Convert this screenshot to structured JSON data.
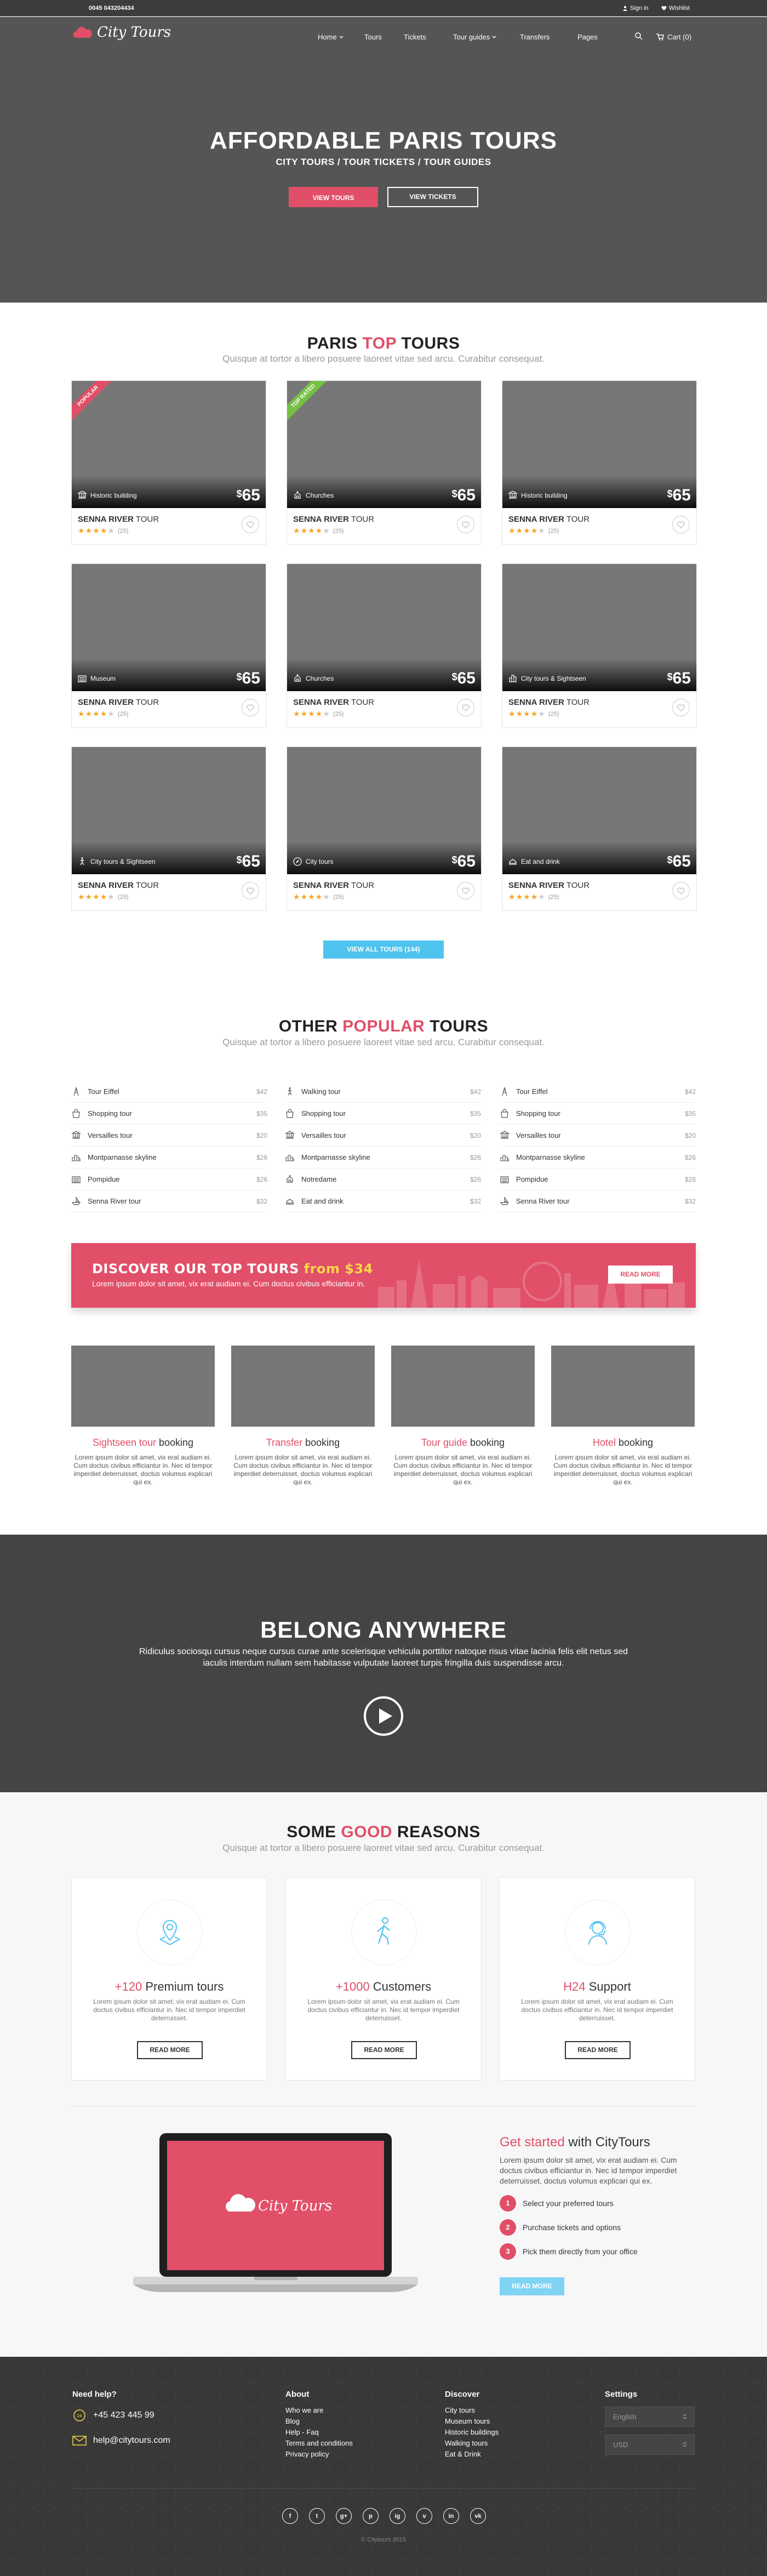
{
  "topbar": {
    "phone": "0045 043204434",
    "signin": "Sign in",
    "wishlist": "Wishlist"
  },
  "header": {
    "brand": "City Tours",
    "nav": [
      "Home",
      "Tours",
      "Tickets",
      "Tour guides",
      "Transfers",
      "Pages"
    ],
    "cart": "Cart (0)"
  },
  "hero": {
    "title": "AFFORDABLE PARIS TOURS",
    "subtitle": "CITY TOURS / TOUR TICKETS / TOUR GUIDES",
    "btn_tours": "VIEW TOURS",
    "btn_tickets": "VIEW TICKETS"
  },
  "top_tours": {
    "title_a": "PARIS ",
    "title_hl": "TOP",
    "title_b": " TOURS",
    "subtitle": "Quisque at tortor a libero posuere laoreet vitae sed arcu. Curabitur consequat.",
    "cards": [
      {
        "ribbon": "POPULAR",
        "ribbon_color": "#e04f67",
        "category": "Historic building",
        "icon": "historic-icon",
        "price": "65",
        "name_a": "SENNA RIVER",
        "name_b": " TOUR",
        "stars": 4,
        "reviews": "(25)"
      },
      {
        "ribbon": "TOP RATED",
        "ribbon_color": "#76c043",
        "category": "Churches",
        "icon": "church-icon",
        "price": "65",
        "name_a": "SENNA RIVER",
        "name_b": " TOUR",
        "stars": 4,
        "reviews": "(25)"
      },
      {
        "ribbon": "",
        "ribbon_color": "",
        "category": "Historic building",
        "icon": "historic-icon",
        "price": "65",
        "name_a": "SENNA RIVER",
        "name_b": " TOUR",
        "stars": 4,
        "reviews": "(25)"
      },
      {
        "ribbon": "",
        "ribbon_color": "",
        "category": "Museum",
        "icon": "museum-icon",
        "price": "65",
        "name_a": "SENNA RIVER",
        "name_b": " TOUR",
        "stars": 4,
        "reviews": "(25)"
      },
      {
        "ribbon": "",
        "ribbon_color": "",
        "category": "Churches",
        "icon": "church-icon",
        "price": "65",
        "name_a": "SENNA RIVER",
        "name_b": " TOUR",
        "stars": 4,
        "reviews": "(25)"
      },
      {
        "ribbon": "",
        "ribbon_color": "",
        "category": "City tours & Sightseen",
        "icon": "city-icon",
        "price": "65",
        "name_a": "SENNA RIVER",
        "name_b": " TOUR",
        "stars": 4,
        "reviews": "(25)"
      },
      {
        "ribbon": "",
        "ribbon_color": "",
        "category": "City tours & Sightseen",
        "icon": "walking-icon",
        "price": "65",
        "name_a": "SENNA RIVER",
        "name_b": " TOUR",
        "stars": 4,
        "reviews": "(25)"
      },
      {
        "ribbon": "",
        "ribbon_color": "",
        "category": "City tours",
        "icon": "compass-icon",
        "price": "65",
        "name_a": "SENNA RIVER",
        "name_b": " TOUR",
        "stars": 4,
        "reviews": "(25)"
      },
      {
        "ribbon": "",
        "ribbon_color": "",
        "category": "Eat and drink",
        "icon": "food-icon",
        "price": "65",
        "name_a": "SENNA RIVER",
        "name_b": " TOUR",
        "stars": 4,
        "reviews": "(25)"
      }
    ],
    "view_all": "VIEW ALL TOURS (144)"
  },
  "popular": {
    "title_a": "OTHER ",
    "title_hl": "POPULAR",
    "title_b": " TOURS",
    "subtitle": "Quisque at tortor a libero posuere laoreet vitae sed arcu. Curabitur consequat.",
    "columns": [
      [
        {
          "name": "Tour Eiffel",
          "price": "$42",
          "icon": "eiffel-icon"
        },
        {
          "name": "Shopping tour",
          "price": "$35",
          "icon": "shopping-icon"
        },
        {
          "name": "Versailles tour",
          "price": "$20",
          "icon": "historic-icon"
        },
        {
          "name": "Montparnasse skyline",
          "price": "$26",
          "icon": "skyline-icon"
        },
        {
          "name": "Pompidue",
          "price": "$26",
          "icon": "museum-icon"
        },
        {
          "name": "Senna River tour",
          "price": "$32",
          "icon": "boat-icon"
        }
      ],
      [
        {
          "name": "Walking tour",
          "price": "$42",
          "icon": "walking-icon"
        },
        {
          "name": "Shopping tour",
          "price": "$35",
          "icon": "shopping-icon"
        },
        {
          "name": "Versailles tour",
          "price": "$20",
          "icon": "historic-icon"
        },
        {
          "name": "Montparnasse skyline",
          "price": "$26",
          "icon": "skyline-icon"
        },
        {
          "name": "Notredame",
          "price": "$26",
          "icon": "church-icon"
        },
        {
          "name": "Eat and drink",
          "price": "$32",
          "icon": "food-icon"
        }
      ],
      [
        {
          "name": "Tour Eiffel",
          "price": "$42",
          "icon": "eiffel-icon"
        },
        {
          "name": "Shopping tour",
          "price": "$35",
          "icon": "shopping-icon"
        },
        {
          "name": "Versailles tour",
          "price": "$20",
          "icon": "historic-icon"
        },
        {
          "name": "Montparnasse skyline",
          "price": "$26",
          "icon": "skyline-icon"
        },
        {
          "name": "Pompidue",
          "price": "$26",
          "icon": "museum-icon"
        },
        {
          "name": "Senna River tour",
          "price": "$32",
          "icon": "boat-icon"
        }
      ]
    ]
  },
  "banner": {
    "title_a": "DISCOVER OUR TOP TOURS ",
    "title_hl": "from $34",
    "subtitle": "Lorem ipsum dolor sit amet, vix erat audiam ei. Cum doctus civibus efficiantur in.",
    "button": "READ MORE"
  },
  "features": [
    {
      "hl": "Sightseen tour",
      "rest": " booking",
      "text": "Lorem ipsum dolor sit amet, vix erat audiam ei. Cum doctus civibus efficiantur in. Nec id tempor imperdiet deterruisset, doctus volumus explicari qui ex."
    },
    {
      "hl": "Transfer",
      "rest": " booking",
      "text": "Lorem ipsum dolor sit amet, vix erat audiam ei. Cum doctus civibus efficiantur in. Nec id tempor imperdiet deterruisset, doctus volumus explicari qui ex."
    },
    {
      "hl": "Tour guide",
      "rest": " booking",
      "text": "Lorem ipsum dolor sit amet, vix erat audiam ei. Cum doctus civibus efficiantur in. Nec id tempor imperdiet deterruisset, doctus volumus explicari qui ex."
    },
    {
      "hl": "Hotel",
      "rest": " booking",
      "text": "Lorem ipsum dolor sit amet, vix erat audiam ei. Cum doctus civibus efficiantur in. Nec id tempor imperdiet deterruisset, doctus volumus explicari qui ex."
    }
  ],
  "video": {
    "title": "BELONG ANYWHERE",
    "text": "Ridiculus sociosqu cursus neque cursus curae ante scelerisque vehicula porttitor natoque risus vitae lacinia felis elit netus sed iaculis interdum nullam sem habitasse vulputate laoreet turpis fringilla duis suspendisse arcu."
  },
  "reasons": {
    "title_a": "SOME ",
    "title_hl": "GOOD",
    "title_b": " REASONS",
    "subtitle": "Quisque at tortor a libero posuere laoreet vitae sed arcu. Curabitur consequat.",
    "boxes": [
      {
        "hl": "+120",
        "rest": " Premium tours",
        "text": "Lorem ipsum dolor sit amet, vix erat audiam ei. Cum doctus civibus efficiantur in. Nec id tempor imperdiet deterruisset.",
        "button": "READ MORE",
        "icon": "map-pin-icon"
      },
      {
        "hl": "+1000",
        "rest": " Customers",
        "text": "Lorem ipsum dolor sit amet, vix erat audiam ei. Cum doctus civibus efficiantur in. Nec id tempor imperdiet deterruisset.",
        "button": "READ MORE",
        "icon": "walker-icon"
      },
      {
        "hl": "H24",
        "rest": " Support",
        "text": "Lorem ipsum dolor sit amet, vix erat audiam ei. Cum doctus civibus efficiantur in. Nec id tempor imperdiet deterruisset.",
        "button": "READ MORE",
        "icon": "support-icon"
      }
    ]
  },
  "get_started": {
    "title_hl": "Get started",
    "title_b": " with CityTours",
    "text": "Lorem ipsum dolor sit amet, vix erat audiam ei. Cum doctus civibus efficiantur in. Nec id tempor imperdiet deterruisset, doctus volumus explicari qui ex.",
    "steps": [
      {
        "num": "1",
        "label": "Select your preferred tours"
      },
      {
        "num": "2",
        "label": "Purchase tickets and options"
      },
      {
        "num": "3",
        "label": "Pick them directly from your office"
      }
    ],
    "button": "READ MORE",
    "laptop_brand": "City Tours"
  },
  "footer": {
    "need_help": "Need help?",
    "phone": "+45 423 445 99",
    "email": "help@citytours.com",
    "about_title": "About",
    "about_links": [
      "Who we are",
      "Blog",
      "Help - Faq",
      "Terms and conditions",
      "Privacy policy"
    ],
    "discover_title": "Discover",
    "discover_links": [
      "City tours",
      "Museum tours",
      "Historic buildings",
      "Walking tours",
      "Eat & Drink"
    ],
    "settings_title": "Settings",
    "language": "English",
    "currency": "USD",
    "social": [
      "f",
      "t",
      "g+",
      "p",
      "ig",
      "v",
      "in",
      "vk"
    ],
    "copyright": "© Citytours 2015"
  },
  "colors": {
    "accent": "#e04f67",
    "blue": "#4fc2ee",
    "green": "#76c043",
    "star": "#f5a623",
    "dark": "#383838"
  }
}
